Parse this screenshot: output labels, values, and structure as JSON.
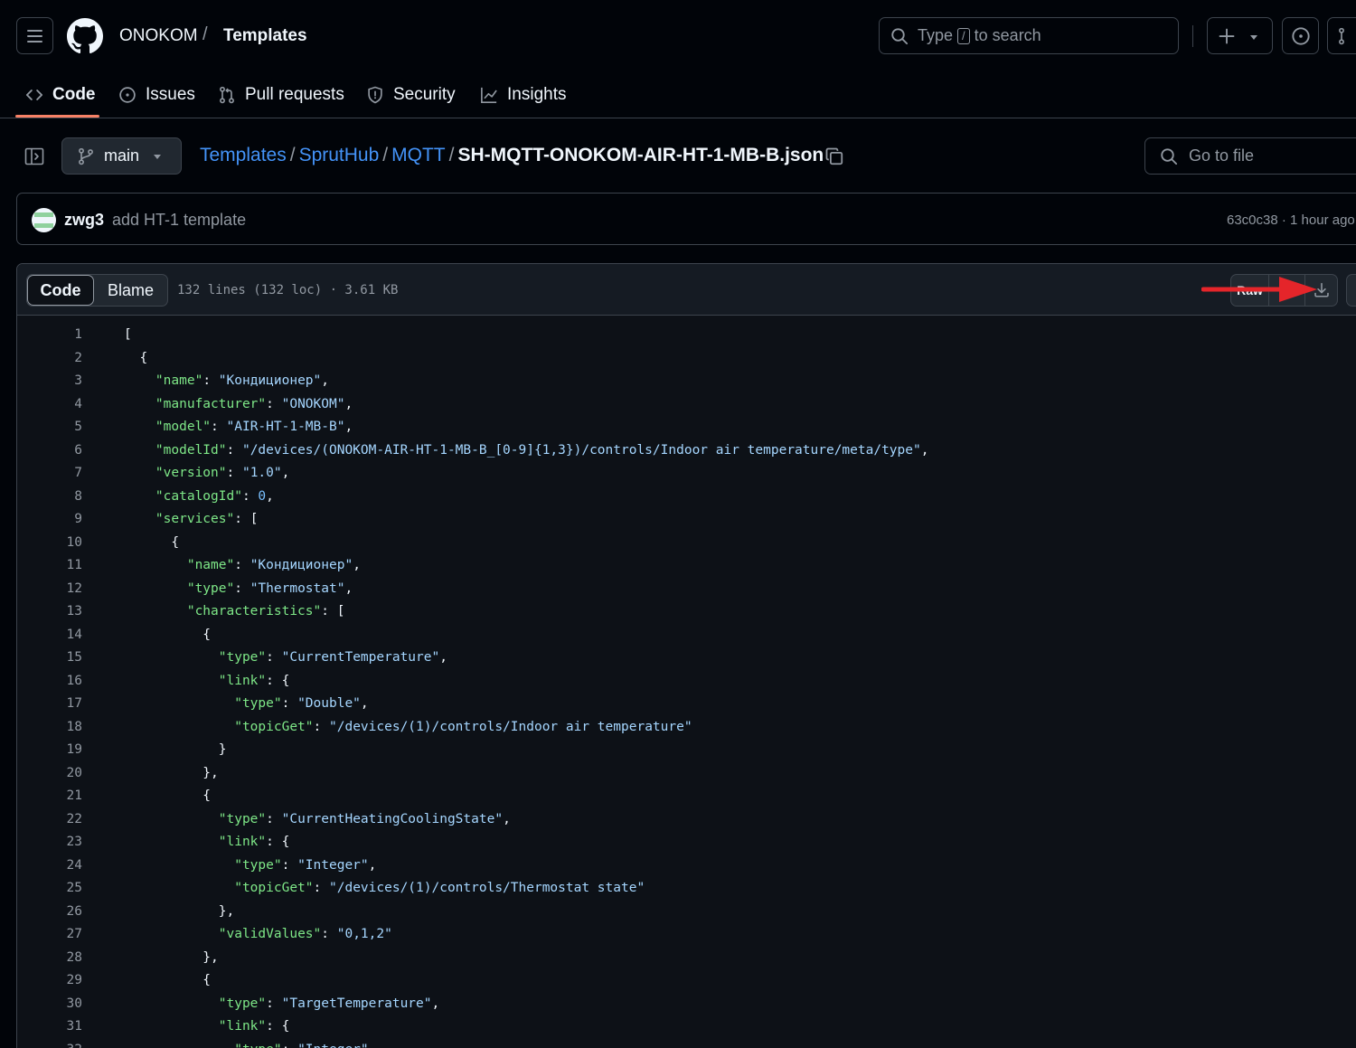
{
  "header": {
    "owner": "ONOKOM",
    "separator": "/",
    "repo": "Templates",
    "search_prefix": "Type",
    "search_key": "/",
    "search_suffix": "to search"
  },
  "tabs": [
    {
      "label": "Code",
      "icon": "code-icon",
      "active": true
    },
    {
      "label": "Issues",
      "icon": "issue-icon"
    },
    {
      "label": "Pull requests",
      "icon": "pull-request-icon"
    },
    {
      "label": "Security",
      "icon": "shield-icon"
    },
    {
      "label": "Insights",
      "icon": "graph-icon"
    }
  ],
  "file_nav": {
    "branch": "main",
    "path": [
      "Templates",
      "SprutHub",
      "MQTT"
    ],
    "path_separator": "/",
    "filename": "SH-MQTT-ONOKOM-AIR-HT-1-MB-B.json",
    "goto_placeholder": "Go to file"
  },
  "commit": {
    "author": "zwg3",
    "message": "add HT-1 template",
    "meta": "63c0c38 · 1 hour ago"
  },
  "viewer": {
    "mode_code": "Code",
    "mode_blame": "Blame",
    "file_info": "132 lines (132 loc) · 3.61 KB",
    "raw_label": "Raw",
    "accent_arrow_color": "#e5252a"
  },
  "code_lines": [
    "[",
    "  {",
    "    \"name\": \"Кондиционер\",",
    "    \"manufacturer\": \"ONOKOM\",",
    "    \"model\": \"AIR-HT-1-MB-B\",",
    "    \"modelId\": \"/devices/(ONOKOM-AIR-HT-1-MB-B_[0-9]{1,3})/controls/Indoor air temperature/meta/type\",",
    "    \"version\": \"1.0\",",
    "    \"catalogId\": 0,",
    "    \"services\": [",
    "      {",
    "        \"name\": \"Кондиционер\",",
    "        \"type\": \"Thermostat\",",
    "        \"characteristics\": [",
    "          {",
    "            \"type\": \"CurrentTemperature\",",
    "            \"link\": {",
    "              \"type\": \"Double\",",
    "              \"topicGet\": \"/devices/(1)/controls/Indoor air temperature\"",
    "            }",
    "          },",
    "          {",
    "            \"type\": \"CurrentHeatingCoolingState\",",
    "            \"link\": {",
    "              \"type\": \"Integer\",",
    "              \"topicGet\": \"/devices/(1)/controls/Thermostat state\"",
    "            },",
    "            \"validValues\": \"0,1,2\"",
    "          },",
    "          {",
    "            \"type\": \"TargetTemperature\",",
    "            \"link\": {",
    "              \"type\": \"Integer\","
  ]
}
